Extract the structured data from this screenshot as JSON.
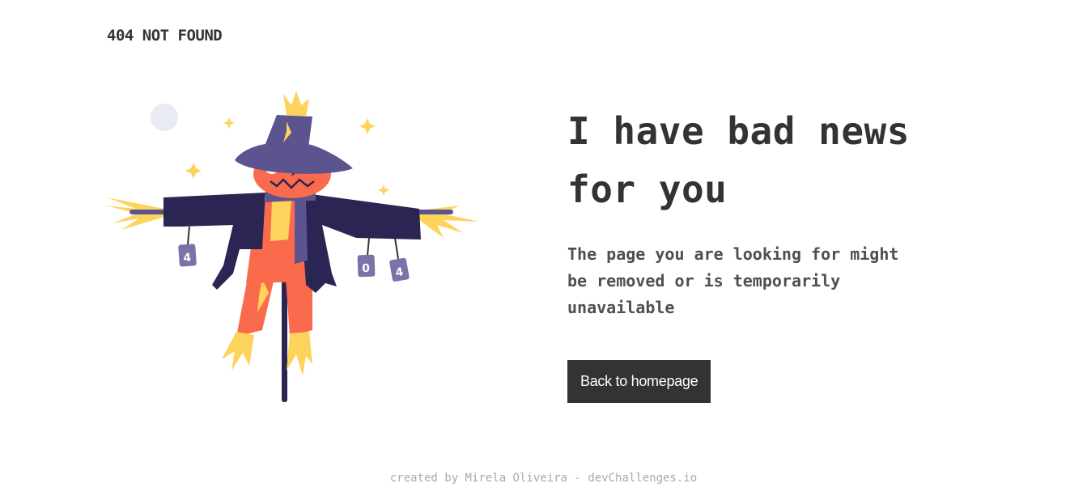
{
  "header": {
    "brand": "404 NOT FOUND"
  },
  "main": {
    "headline_line1": "I have bad news",
    "headline_line2": "for you",
    "message": "The page you are looking for might be removed or is temporarily unavailable",
    "home_button_label": "Back to homepage"
  },
  "illustration": {
    "subject": "scarecrow",
    "can_labels": [
      "4",
      "0",
      "4"
    ]
  },
  "footer": {
    "credit": "created by Mirela Oliveira - devChallenges.io"
  },
  "colors": {
    "text": "#333333",
    "button_bg": "#333333",
    "button_text": "#ffffff",
    "footer_text": "#a9a9a9",
    "hat": "#5c548e",
    "coat": "#2b2553",
    "face": "#fa6b4e",
    "straw": "#fdd35c",
    "moon": "#e8eaf6"
  }
}
